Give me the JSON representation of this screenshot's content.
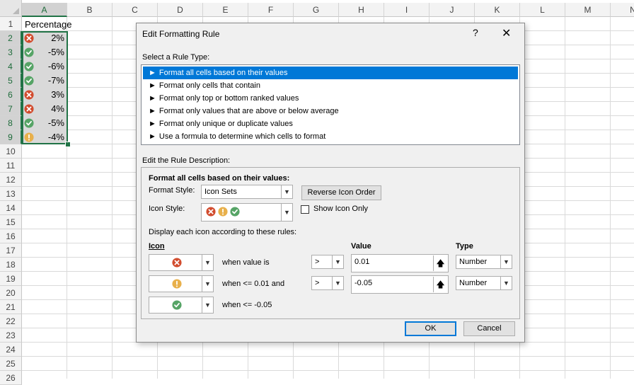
{
  "sheet": {
    "columns": [
      "A",
      "B",
      "C",
      "D",
      "E",
      "F",
      "G",
      "H",
      "I",
      "J",
      "K",
      "L",
      "M",
      "N"
    ],
    "rows": [
      "1",
      "2",
      "3",
      "4",
      "5",
      "6",
      "7",
      "8",
      "9",
      "10",
      "11",
      "12",
      "13",
      "14",
      "15",
      "16",
      "17",
      "18",
      "19",
      "20",
      "21",
      "22",
      "23",
      "24",
      "25",
      "26"
    ],
    "a1": "Percentage",
    "data": [
      {
        "icon": "red-x-icon",
        "value": "2%"
      },
      {
        "icon": "green-check-icon",
        "value": "-5%"
      },
      {
        "icon": "green-check-icon",
        "value": "-6%"
      },
      {
        "icon": "green-check-icon",
        "value": "-7%"
      },
      {
        "icon": "red-x-icon",
        "value": "3%"
      },
      {
        "icon": "red-x-icon",
        "value": "4%"
      },
      {
        "icon": "green-check-icon",
        "value": "-5%"
      },
      {
        "icon": "yellow-exclamation-icon",
        "value": "-4%"
      }
    ]
  },
  "dialog": {
    "title": "Edit Formatting Rule",
    "help": "?",
    "close": "✕",
    "select_rule_label": "Select a Rule Type:",
    "rule_types": [
      "Format all cells based on their values",
      "Format only cells that contain",
      "Format only top or bottom ranked values",
      "Format only values that are above or below average",
      "Format only unique or duplicate values",
      "Use a formula to determine which cells to format"
    ],
    "edit_desc_label": "Edit the Rule Description:",
    "desc_heading": "Format all cells based on their values:",
    "format_style_label": "Format Style:",
    "format_style_value": "Icon Sets",
    "reverse_btn": "Reverse Icon Order",
    "icon_style_label": "Icon Style:",
    "show_icon_only": "Show Icon Only",
    "display_rules_label": "Display each icon according to these rules:",
    "col_icon": "Icon",
    "col_value": "Value",
    "col_type": "Type",
    "rules": [
      {
        "icon": "red-x-icon",
        "text": "when value is",
        "op": ">",
        "value": "0.01",
        "type": "Number"
      },
      {
        "icon": "yellow-exclamation-icon",
        "text": "when <= 0.01 and",
        "op": ">",
        "value": "-0.05",
        "type": "Number"
      },
      {
        "icon": "green-check-icon",
        "text": "when <= -0.05"
      }
    ],
    "ok": "OK",
    "cancel": "Cancel"
  },
  "colors": {
    "accent": "#0078d7",
    "excel_green": "#217346",
    "red_icon": "#d24c2e",
    "yellow_icon": "#e8b04b",
    "green_icon": "#56a466"
  }
}
